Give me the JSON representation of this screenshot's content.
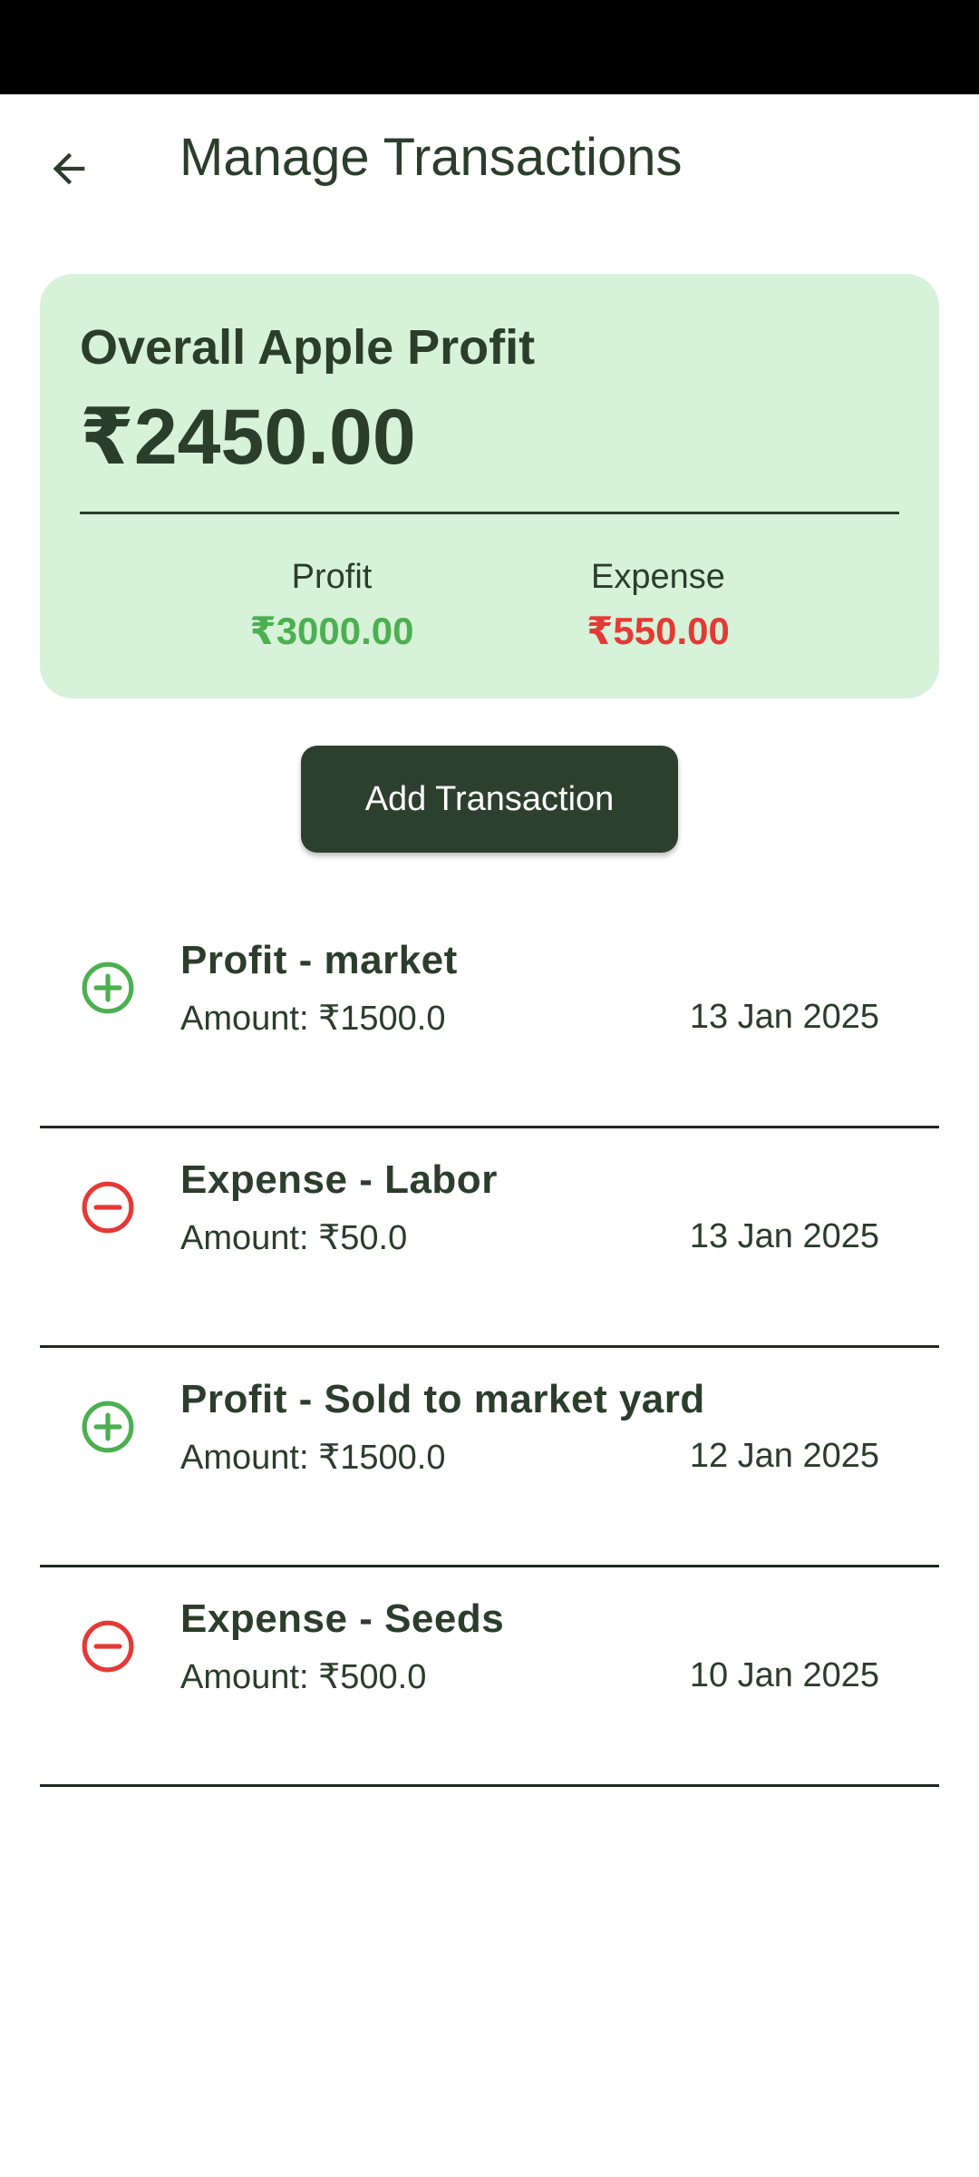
{
  "app_bar": {
    "title": "Manage Transactions",
    "back_icon": "arrow-back-icon"
  },
  "summary": {
    "heading": "Overall Apple Profit",
    "total": "₹2450.00",
    "profit_label": "Profit",
    "profit_value": "₹3000.00",
    "expense_label": "Expense",
    "expense_value": "₹550.00"
  },
  "actions": {
    "add_label": "Add Transaction"
  },
  "colors": {
    "card_bg": "#d6f2d8",
    "primary_dark": "#2d402d",
    "profit_green": "#4caf50",
    "expense_red": "#e53935"
  },
  "transactions": [
    {
      "title": "Profit - market",
      "amount": "Amount: ₹1500.0",
      "date": "13 Jan 2025",
      "icon": "add-circle-outline-icon"
    },
    {
      "title": "Expense - Labor",
      "amount": "Amount: ₹50.0",
      "date": "13 Jan 2025",
      "icon": "remove-circle-outline-icon"
    },
    {
      "title": "Profit - Sold to market yard",
      "amount": "Amount: ₹1500.0",
      "date": "12 Jan 2025",
      "icon": "add-circle-outline-icon"
    },
    {
      "title": "Expense - Seeds",
      "amount": "Amount: ₹500.0",
      "date": "10 Jan 2025",
      "icon": "remove-circle-outline-icon"
    }
  ]
}
